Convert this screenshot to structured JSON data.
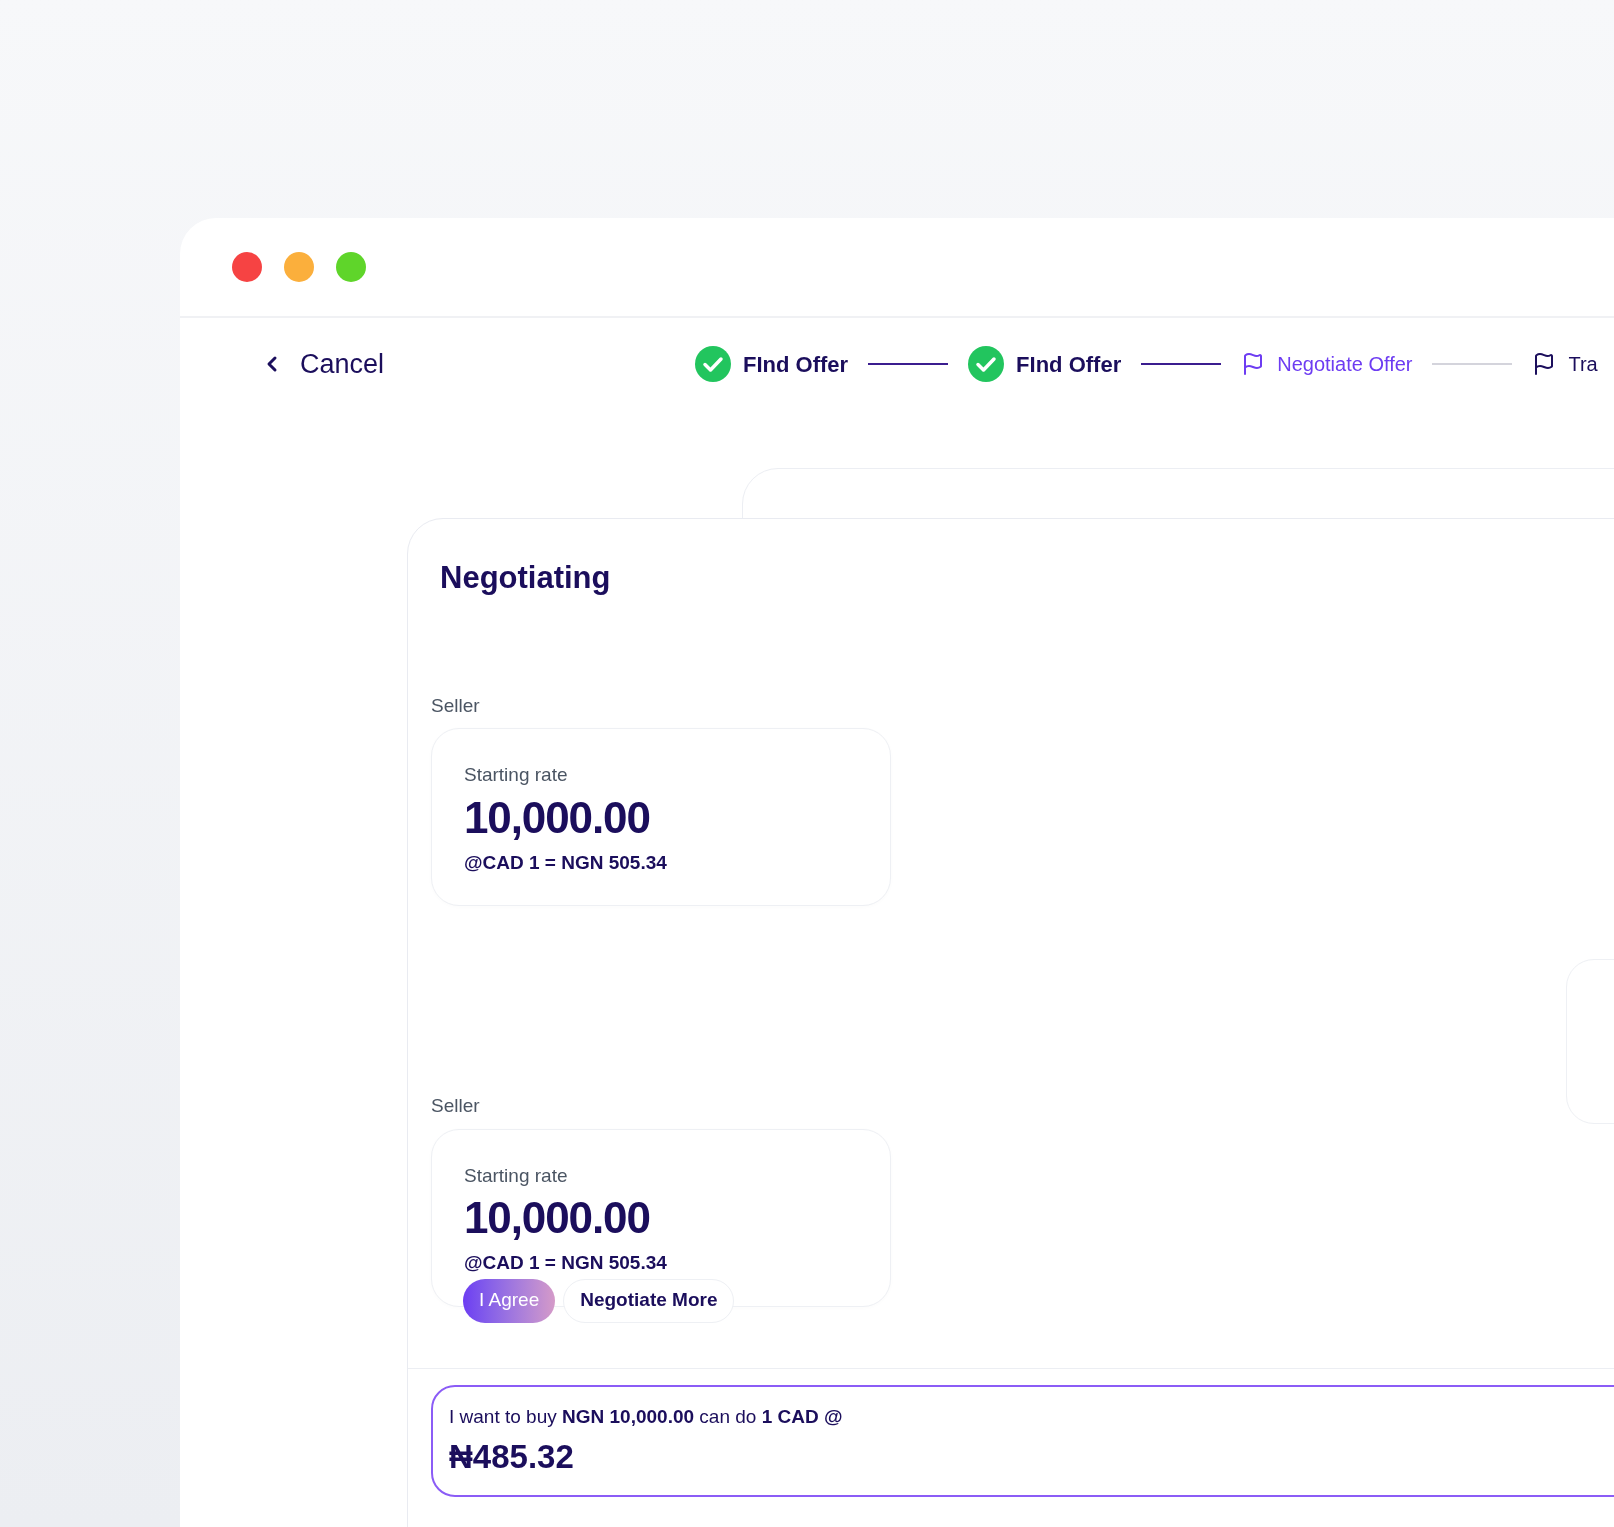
{
  "nav": {
    "back_label": "Cancel"
  },
  "steps": [
    {
      "label": "FInd Offer",
      "kind": "done"
    },
    {
      "label": "FInd Offer",
      "kind": "done"
    },
    {
      "label": "Negotiate Offer",
      "kind": "current"
    },
    {
      "label": "Tra",
      "kind": "upcoming"
    }
  ],
  "panel": {
    "title": "Negotiating"
  },
  "offers": [
    {
      "party": "Seller",
      "caption": "Starting rate",
      "amount": "10,000.00",
      "rate": "@CAD 1 = NGN 505.34"
    },
    {
      "party": "Seller",
      "caption": "Starting rate",
      "amount": "10,000.00",
      "rate": "@CAD 1 = NGN 505.34",
      "actions": [
        {
          "label": "I Agree",
          "kind": "primary"
        },
        {
          "label": "Negotiate More",
          "kind": "secondary"
        }
      ]
    }
  ],
  "composer": {
    "prompt": "I want to buy **NGN 10,000.00** can do **1 CAD @**",
    "value": "₦485.32"
  }
}
